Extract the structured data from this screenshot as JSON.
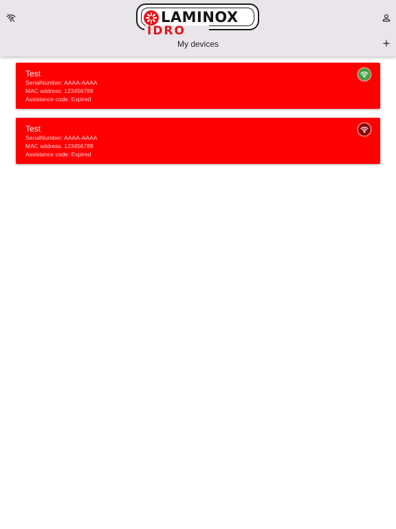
{
  "header": {
    "logo": {
      "brand": "LAMINOX",
      "sub": "IDRO"
    },
    "title": "My devices",
    "icons": {
      "left": "wifi-off-icon",
      "right": "account-icon",
      "add": "add-icon"
    }
  },
  "devices": [
    {
      "name": "Test",
      "serial": "SerialNumber: AAAA-AAAA",
      "mac": "MAC address: 123456789",
      "assistance": "Assistance code: Expired",
      "status_icon": "wifi-online-icon",
      "status_color": "#43a047"
    },
    {
      "name": "Test",
      "serial": "SerialNumber: AAAA-AAAA",
      "mac": "MAC address: 123456789",
      "assistance": "Assistance code: Expired",
      "status_icon": "wifi-offline-icon",
      "status_color": "#8b0000"
    }
  ],
  "colors": {
    "header_bg": "#e9e5ea",
    "card_bg": "#ff0000",
    "brand_red": "#e3161c",
    "online": "#43a047",
    "offline": "#8b0000"
  }
}
